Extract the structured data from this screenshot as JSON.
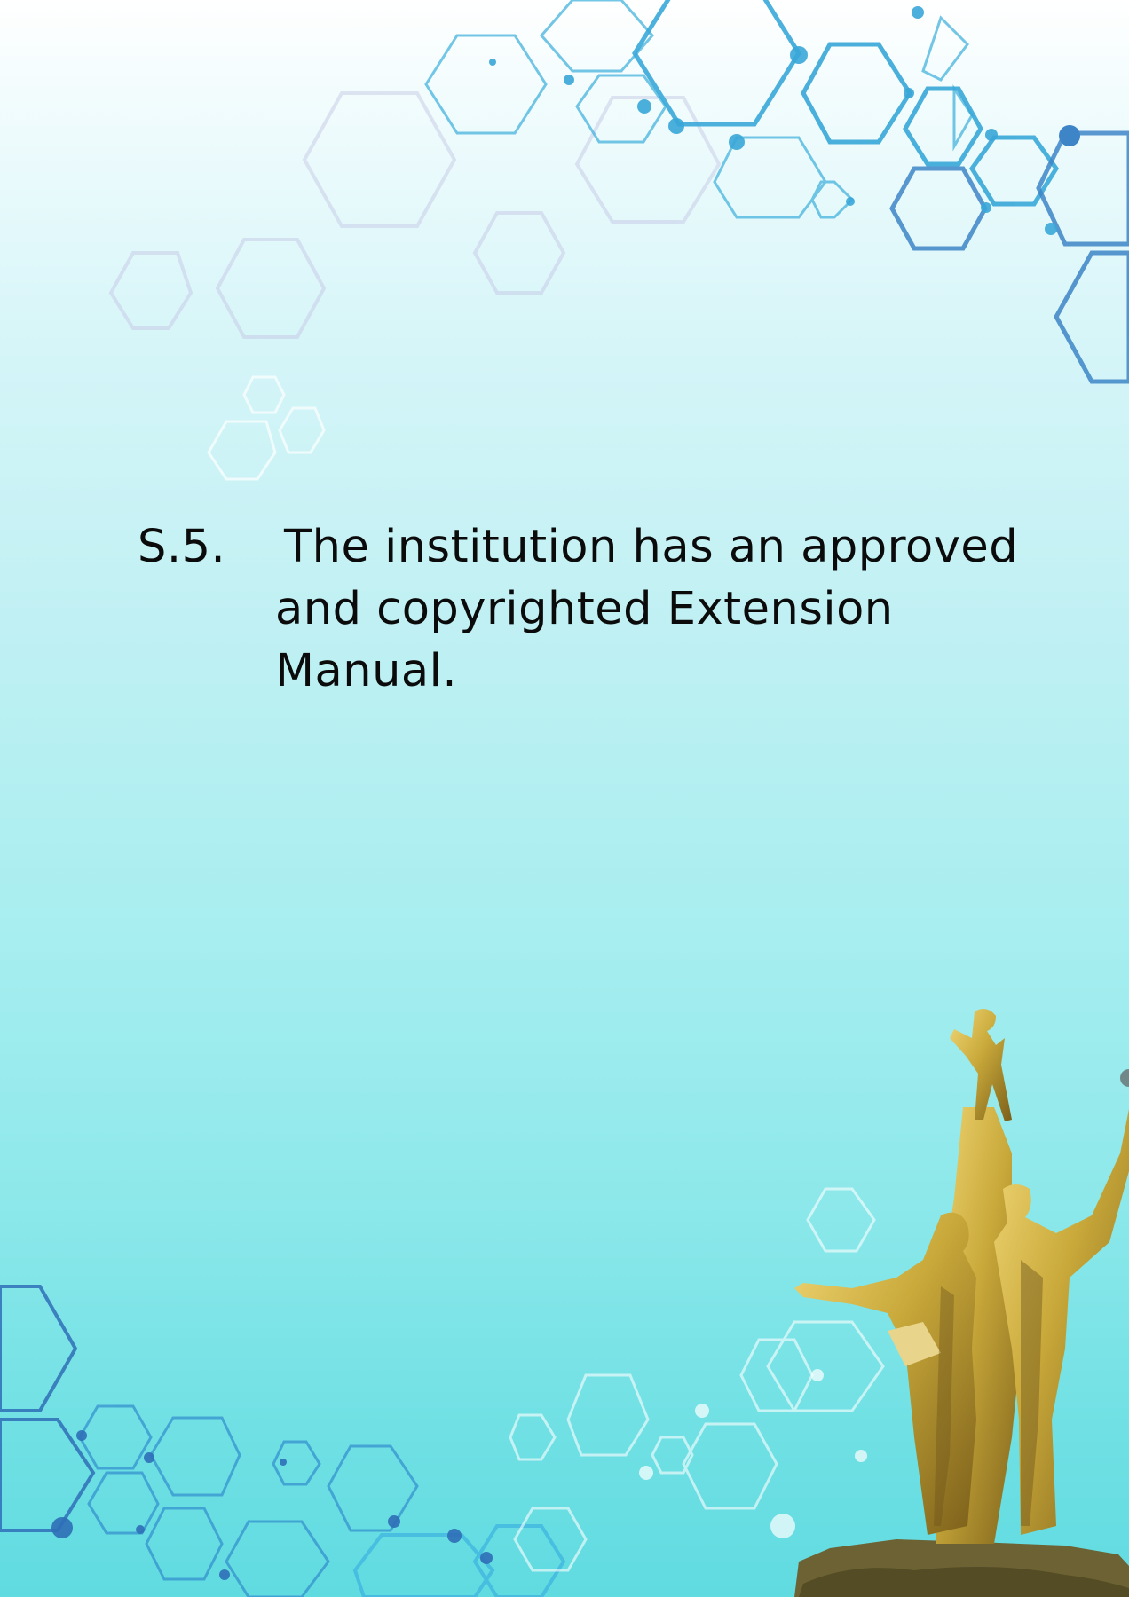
{
  "statement": {
    "number": "S.5.",
    "lines": [
      "The institution has an approved",
      "and copyrighted Extension",
      "Manual."
    ]
  },
  "decor": {
    "hexagon_color": "#3fa9d6",
    "hexagon_dark": "#2f6fb7",
    "hexagon_light": "#ffffff",
    "statue_gold": "#c9a93a"
  }
}
